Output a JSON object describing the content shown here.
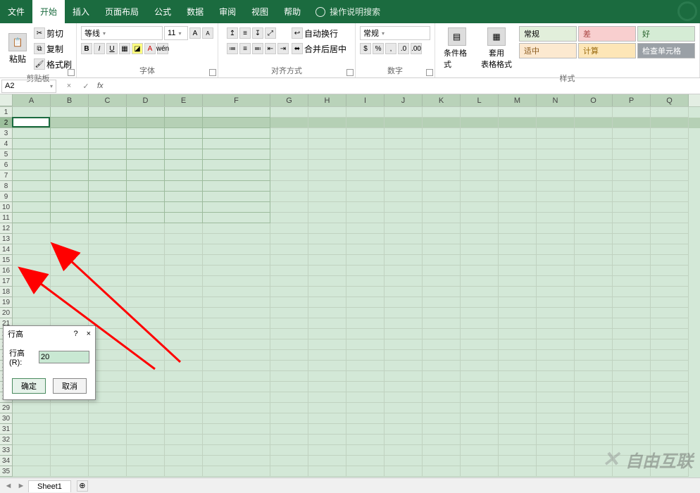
{
  "tabs": {
    "file": "文件",
    "home": "开始",
    "insert": "插入",
    "layout": "页面布局",
    "formulas": "公式",
    "data": "数据",
    "review": "审阅",
    "view": "视图",
    "help": "帮助",
    "search": "操作说明搜索"
  },
  "ribbon": {
    "clipboard": {
      "paste": "粘贴",
      "cut": "剪切",
      "copy": "复制",
      "format_painter": "格式刷",
      "label": "剪贴板"
    },
    "font": {
      "name": "等线",
      "size": "11",
      "label": "字体"
    },
    "alignment": {
      "wrap": "自动换行",
      "merge": "合并后居中",
      "label": "对齐方式"
    },
    "number": {
      "format": "常规",
      "label": "数字"
    },
    "styles": {
      "conditional": "条件格式",
      "table_format": "套用\n表格格式",
      "cells": [
        {
          "cls": "normal",
          "text": "常规"
        },
        {
          "cls": "bad",
          "text": "差"
        },
        {
          "cls": "good",
          "text": "好"
        },
        {
          "cls": "med",
          "text": "适中"
        },
        {
          "cls": "calc",
          "text": "计算"
        },
        {
          "cls": "check",
          "text": "检查单元格"
        }
      ],
      "label": "样式"
    }
  },
  "formula_bar": {
    "name_box": "A2",
    "fx": "fx"
  },
  "grid": {
    "columns": [
      {
        "l": "A",
        "w": 54
      },
      {
        "l": "B",
        "w": 54
      },
      {
        "l": "C",
        "w": 54
      },
      {
        "l": "D",
        "w": 54
      },
      {
        "l": "E",
        "w": 54
      },
      {
        "l": "F",
        "w": 96
      },
      {
        "l": "G",
        "w": 54
      },
      {
        "l": "H",
        "w": 54
      },
      {
        "l": "I",
        "w": 54
      },
      {
        "l": "J",
        "w": 54
      },
      {
        "l": "K",
        "w": 54
      },
      {
        "l": "L",
        "w": 54
      },
      {
        "l": "M",
        "w": 54
      },
      {
        "l": "N",
        "w": 54
      },
      {
        "l": "O",
        "w": 54
      },
      {
        "l": "P",
        "w": 54
      },
      {
        "l": "Q",
        "w": 54
      }
    ],
    "row_count": 35,
    "selected_row": 2,
    "active_cell": {
      "row": 2,
      "col": 0
    },
    "gridline_break_after_col": 5
  },
  "dialog": {
    "title": "行高",
    "help": "?",
    "close": "×",
    "label": "行高(R):",
    "value": "20",
    "ok": "确定",
    "cancel": "取消"
  },
  "sheet_bar": {
    "sheet1": "Sheet1",
    "add": "⊕"
  },
  "watermark": {
    "text": "自由互联"
  }
}
